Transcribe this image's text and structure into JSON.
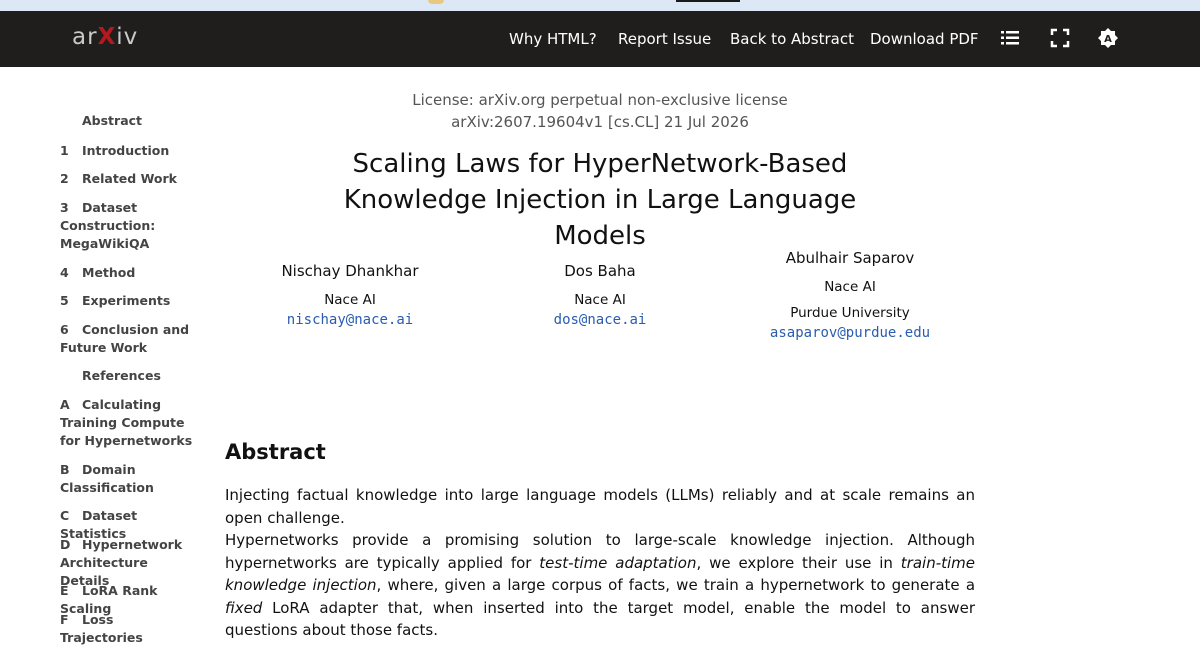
{
  "navbar": {
    "logo": "arXiv",
    "links": [
      "Why HTML?",
      "Report Issue",
      "Back to Abstract",
      "Download PDF"
    ],
    "icons": [
      "list-icon",
      "fullscreen-icon",
      "theme-icon"
    ]
  },
  "toc": [
    {
      "num": "",
      "label": "Abstract"
    },
    {
      "num": "1",
      "label": "Introduction"
    },
    {
      "num": "2",
      "label": "Related Work"
    },
    {
      "num": "3",
      "label": "Dataset Construction: MegaWikiQA"
    },
    {
      "num": "4",
      "label": "Method"
    },
    {
      "num": "5",
      "label": "Experiments"
    },
    {
      "num": "6",
      "label": "Conclusion and Future Work"
    },
    {
      "num": "",
      "label": "References"
    },
    {
      "num": "A",
      "label": "Calculating Training Compute for Hypernetworks"
    },
    {
      "num": "B",
      "label": "Domain Classification"
    },
    {
      "num": "C",
      "label": "Dataset Statistics"
    },
    {
      "num": "D",
      "label": "Hypernetwork Architecture Details"
    },
    {
      "num": "E",
      "label": "LoRA Rank Scaling"
    },
    {
      "num": "F",
      "label": "Loss Trajectories"
    }
  ],
  "paper": {
    "license": "License: arXiv.org perpetual non-exclusive license",
    "id_line": "arXiv:2607.19604v1 [cs.CL] 21 Jul 2026",
    "title_line1": "Scaling Laws for HyperNetwork-Based",
    "title_line2": "Knowledge Injection in Large Language Models",
    "authors": [
      {
        "name": "Nischay Dhankhar",
        "affil": "Nace AI",
        "affil2": "",
        "email": "nischay@nace.ai"
      },
      {
        "name": "Dos Baha",
        "affil": "Nace AI",
        "affil2": "",
        "email": "dos@nace.ai"
      },
      {
        "name": "Abulhair Saparov",
        "affil": "Nace AI",
        "affil2": "Purdue University",
        "email": "asaparov@purdue.edu"
      }
    ],
    "abstract_heading": "Abstract",
    "abstract_p1": "Injecting factual knowledge into large language models (LLMs) reliably and at scale remains an open challenge.",
    "abstract_p2": {
      "a": "Hypernetworks provide a promising solution to large-scale knowledge injection. Although hypernetworks are typically applied for ",
      "b": "test-time adaptation",
      "c": ", we explore their use in ",
      "d": "train-time knowledge injection",
      "e": ", where, given a large corpus of facts, we train a hypernetwork to generate a ",
      "f": "fixed",
      "g": " LoRA adapter that, when inserted into the target model, enable the model to answer questions about those facts."
    }
  }
}
